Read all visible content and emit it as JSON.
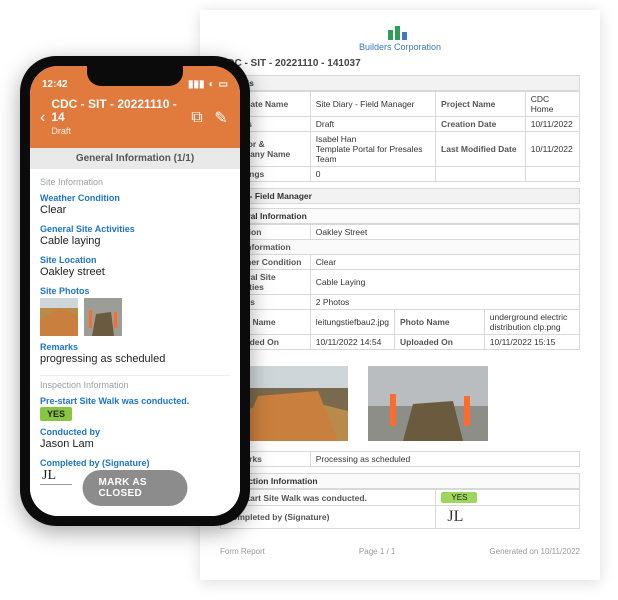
{
  "report": {
    "company": "Builders Corporation",
    "report_title": "CDC - SIT - 20221110 - 141037",
    "details_heading": "Details",
    "details": {
      "template_name_k": "Template Name",
      "template_name_v": "Site Diary - Field Manager",
      "project_name_k": "Project Name",
      "project_name_v": "CDC Home",
      "status_k": "Status",
      "status_v": "Draft",
      "creation_date_k": "Creation Date",
      "creation_date_v": "10/11/2022",
      "creator_k": "Creator & Company Name",
      "creator_v": "Isabel Han\nTemplate Portal for Presales Team",
      "last_mod_k": "Last Modified Date",
      "last_mod_v": "10/11/2022",
      "drawings_k": "Drawings",
      "drawings_v": "0"
    },
    "diary_heading": "Diary - Field Manager",
    "general_info_heading": "General Information",
    "site_info_heading": "Site Information",
    "gen": {
      "location_k": "Location",
      "location_v": "Oakley Street",
      "weather_k": "Weather Condition",
      "weather_v": "Clear",
      "activities_k": "General Site Activities",
      "activities_v": "Cable Laying",
      "photos_k": "Photos",
      "photos_v": "2 Photos",
      "p1name_k": "Photo Name",
      "p1name_v": "leitungstiefbau2.jpg",
      "p2name_k": "Photo Name",
      "p2name_v": "underground electric distribution clp.png",
      "up1_k": "Uploaded On",
      "up1_v": "10/11/2022 14:54",
      "up2_k": "Uploaded On",
      "up2_v": "10/11/2022 15:15",
      "remarks_k": "Remarks",
      "remarks_v": "Processing as scheduled"
    },
    "inspection_heading": "Inspection Information",
    "insp": {
      "prestart_k": "Pre-start Site Walk was conducted.",
      "prestart_v": "YES",
      "completed_k": "Completed by (Signature)",
      "signature": "JL"
    },
    "footer": {
      "left": "Form Report",
      "mid": "Page 1 / 1",
      "right": "Generated on 10/11/2022"
    }
  },
  "phone": {
    "status_time": "12:42",
    "header_title": "CDC - SIT - 20221110 - 14",
    "header_sub": "Draft",
    "section_header": "General Information (1/1)",
    "labels": {
      "site_info": "Site Information",
      "weather": "Weather Condition",
      "activities": "General Site Activities",
      "location": "Site Location",
      "photos": "Site Photos",
      "remarks": "Remarks",
      "inspection": "Inspection Information",
      "prestart": "Pre-start Site Walk was conducted.",
      "conducted_by": "Conducted by",
      "completed_by": "Completed by (Signature)"
    },
    "values": {
      "weather": "Clear",
      "activities": "Cable laying",
      "location": "Oakley street",
      "remarks": "progressing as scheduled",
      "prestart": "YES",
      "conducted_by": "Jason Lam",
      "signature": "JL"
    },
    "close_button": "MARK AS CLOSED"
  },
  "icons": {
    "back": "‹",
    "copy": "⧉",
    "edit": "✎"
  }
}
